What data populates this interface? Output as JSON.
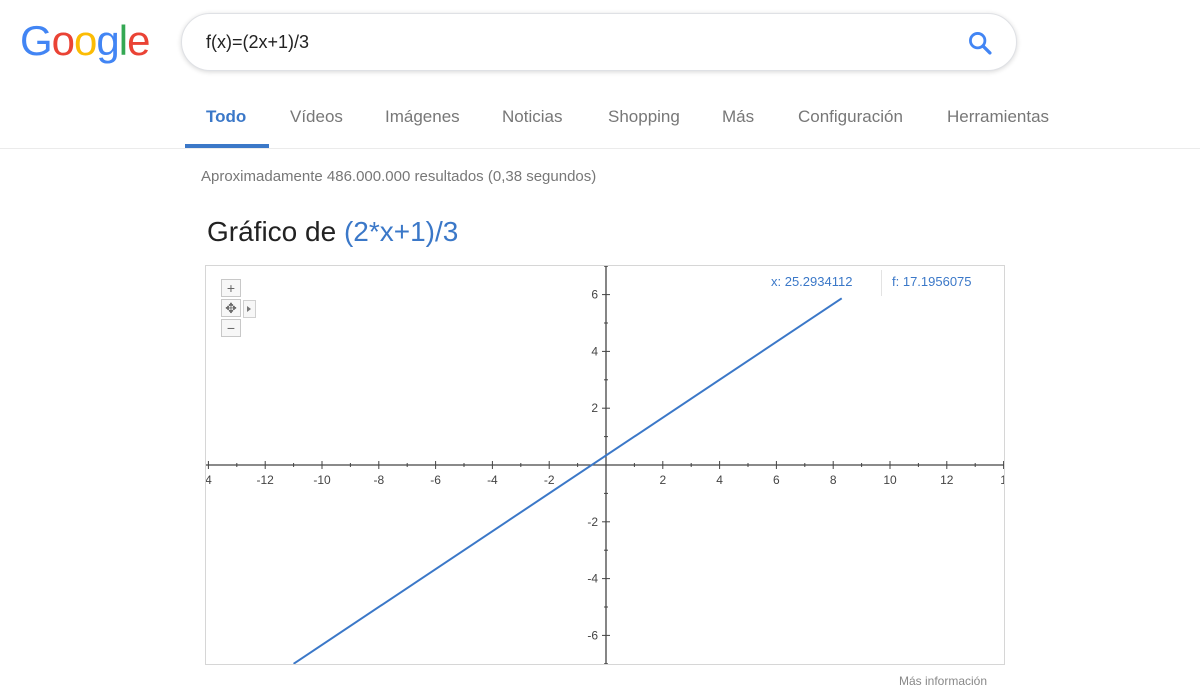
{
  "logo": {
    "letters": [
      "G",
      "o",
      "o",
      "g",
      "l",
      "e"
    ],
    "colors": [
      "#4285f4",
      "#ea4335",
      "#fbbc05",
      "#4285f4",
      "#34a853",
      "#ea4335"
    ]
  },
  "search": {
    "query": "f(x)=(2x+1)/3",
    "icon": "search-icon"
  },
  "tabs": [
    {
      "label": "Todo",
      "active": true
    },
    {
      "label": "Vídeos",
      "active": false
    },
    {
      "label": "Imágenes",
      "active": false
    },
    {
      "label": "Noticias",
      "active": false
    },
    {
      "label": "Shopping",
      "active": false
    },
    {
      "label": "Más",
      "active": false
    },
    {
      "label": "Configuración",
      "active": false
    },
    {
      "label": "Herramientas",
      "active": false
    }
  ],
  "result_stats": "Aproximadamente 486.000.000 resultados (0,38 segundos)",
  "graph": {
    "title_prefix": "Gráfico de ",
    "function": "(2*x+1)/3",
    "readout_x": "x: 25.2934112",
    "readout_f": "f: 17.1956075",
    "more_info": "Más información",
    "zoom_in": "+",
    "zoom_out": "−",
    "pan": "✥"
  },
  "colors": {
    "accent": "#3b78c8",
    "line": "#3b78c8",
    "axis": "#444444"
  },
  "chart_data": {
    "type": "line",
    "title": "Gráfico de (2*x+1)/3",
    "xlim": [
      -14,
      14
    ],
    "ylim": [
      -7,
      7
    ],
    "x_ticks": [
      "4",
      "-12",
      "-10",
      "-8",
      "-6",
      "-4",
      "-2",
      "2",
      "4",
      "6",
      "8",
      "10",
      "12",
      "1"
    ],
    "y_ticks": [
      "6",
      "4",
      "2",
      "-2",
      "-4",
      "-6"
    ],
    "series": [
      {
        "x": [
          -11,
          8.3
        ],
        "y": [
          -7,
          5.87
        ]
      }
    ]
  }
}
